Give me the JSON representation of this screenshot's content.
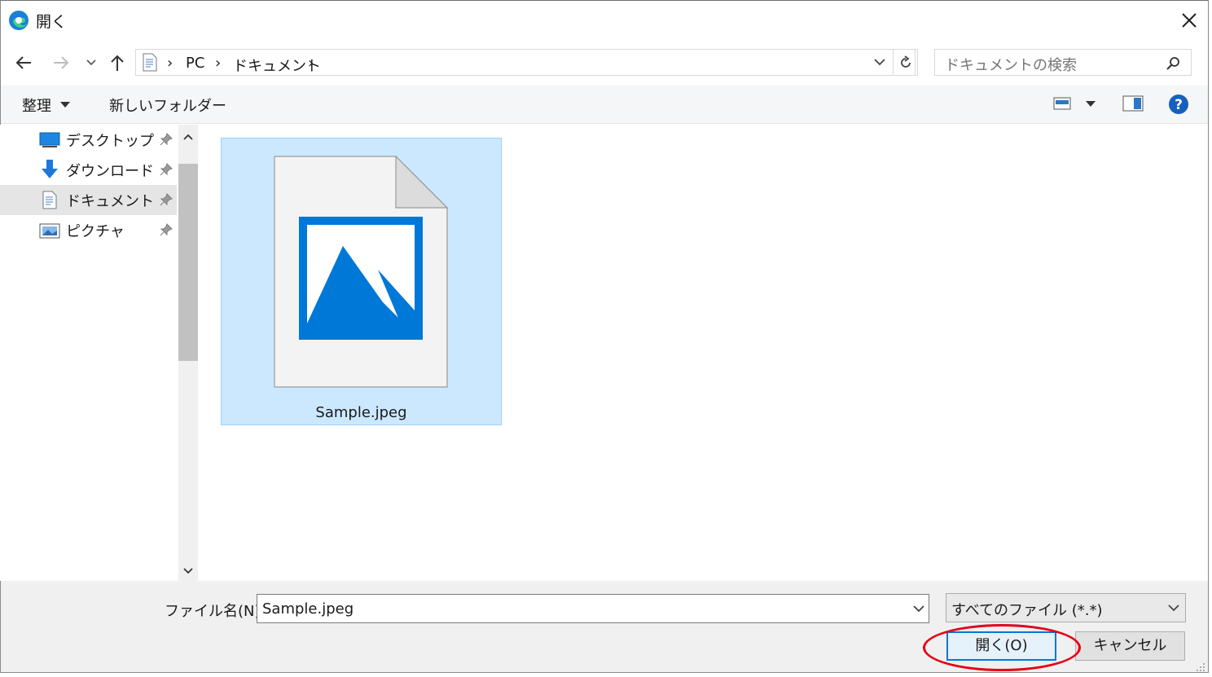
{
  "window": {
    "title": "開く"
  },
  "nav": {
    "breadcrumb": [
      "PC",
      "ドキュメント"
    ],
    "search_placeholder": "ドキュメントの検索"
  },
  "toolbar": {
    "organize_label": "整理",
    "new_folder_label": "新しいフォルダー"
  },
  "sidebar": {
    "items": [
      {
        "label": "デスクトップ",
        "icon": "desktop-icon",
        "selected": false
      },
      {
        "label": "ダウンロード",
        "icon": "download-icon",
        "selected": false
      },
      {
        "label": "ドキュメント",
        "icon": "document-icon",
        "selected": true
      },
      {
        "label": "ピクチャ",
        "icon": "pictures-icon",
        "selected": false
      }
    ]
  },
  "files": [
    {
      "name": "Sample.jpeg",
      "icon": "image-file-icon",
      "selected": true
    }
  ],
  "footer": {
    "filename_label": "ファイル名(N):",
    "filename_value": "Sample.jpeg",
    "filetype_value": "すべてのファイル (*.*)",
    "open_label": "開く(O)",
    "cancel_label": "キャンセル"
  },
  "colors": {
    "accent": "#0078d7",
    "selection": "#cce8ff",
    "annotation": "#e60012"
  }
}
